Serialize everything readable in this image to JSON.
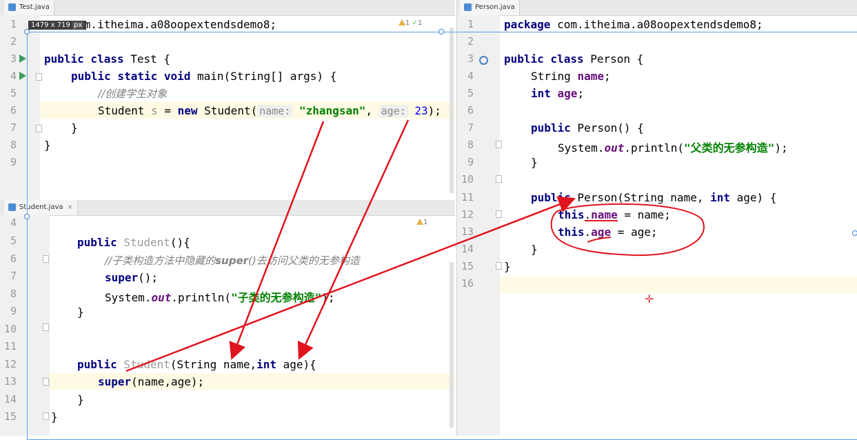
{
  "test_tab": {
    "name": "Test.java"
  },
  "student_tab": {
    "name": "Student.java",
    "close": "×"
  },
  "person_tab": {
    "name": "Person.java"
  },
  "size_readout": {
    "width": "1479",
    "x": "x",
    "height": "719",
    "unit": "px"
  },
  "warnings": {
    "test": "1",
    "test_ok": "1",
    "student": "1"
  },
  "test_code": {
    "lines": [
      "1",
      "2",
      "3",
      "4",
      "5",
      "6",
      "7",
      "8",
      "9"
    ],
    "pkg_tail": "e com.itheima.a08oopextendsdemo8;",
    "l3_kw": "public class",
    "l3_rest": " Test {",
    "l4_kw": "public static void",
    "l4_rest": " main(String[] args) {",
    "l5_cmt": "//创建学生对象",
    "l6_a": "Student ",
    "l6_var": "s",
    "l6_b": " = ",
    "l6_new": "new",
    "l6_c": " Student(",
    "l6_hint1": "name:",
    "l6_str": "\"zhangsan\"",
    "l6_comma": ",",
    "l6_hint2": "age:",
    "l6_num": "23",
    "l6_end": ");",
    "l7": "}",
    "l8": "}"
  },
  "student_code": {
    "lines": [
      "4",
      "5",
      "6",
      "7",
      "8",
      "9",
      "10",
      "11",
      "12",
      "13",
      "14",
      "15"
    ],
    "l5_kw": "public",
    "l5_name": " Student",
    "l5_rest": "(){",
    "l6_cmt_a": "//子类构造方法中隐藏的",
    "l6_super": "super",
    "l6_cmt_b": "()去访问父类的无参构造",
    "l7_super": "super",
    "l7_rest": "();",
    "l8_a": "System.",
    "l8_out": "out",
    "l8_b": ".println(",
    "l8_str": "\"子类的无参构造\"",
    "l8_c": ");",
    "l9": "}",
    "l12_kw": "public",
    "l12_name": " Student",
    "l12_a": "(String name,",
    "l12_int": "int",
    "l12_b": " age){",
    "l13_super": "super",
    "l13_rest": "(name,age);",
    "l14": "}",
    "l15": "}"
  },
  "person_code": {
    "lines": [
      "1",
      "2",
      "3",
      "4",
      "5",
      "6",
      "7",
      "8",
      "9",
      "10",
      "11",
      "12",
      "13",
      "14",
      "15",
      "16"
    ],
    "l1_kw": "package",
    "l1_rest": " com.itheima.a08oopextendsdemo8;",
    "l3_kw": "public class",
    "l3_rest": " Person {",
    "l4_a": "String ",
    "l4_f": "name",
    "l4_b": ";",
    "l5_kw": "int",
    "l5_f": " age",
    "l5_b": ";",
    "l7_kw": "public",
    "l7_rest": " Person() {",
    "l8_a": "System.",
    "l8_out": "out",
    "l8_b": ".println(",
    "l8_str": "\"父类的无参构造\"",
    "l8_c": ");",
    "l9": "}",
    "l11_kw": "public",
    "l11_rest": " Person(String name, ",
    "l11_int": "int",
    "l11_end": " age) {",
    "l12_this": "this",
    "l12_dot": ".",
    "l12_f": "name",
    "l12_rest": " = name;",
    "l13_this": "this",
    "l13_dot": ".",
    "l13_f": "age",
    "l13_rest": " = age;",
    "l14": "}",
    "l15": "}"
  },
  "colors": {
    "keyword": "#000080",
    "field": "#660e7a",
    "string": "#008000",
    "annotation": "#e0141e",
    "highlight": "#fffae3"
  }
}
